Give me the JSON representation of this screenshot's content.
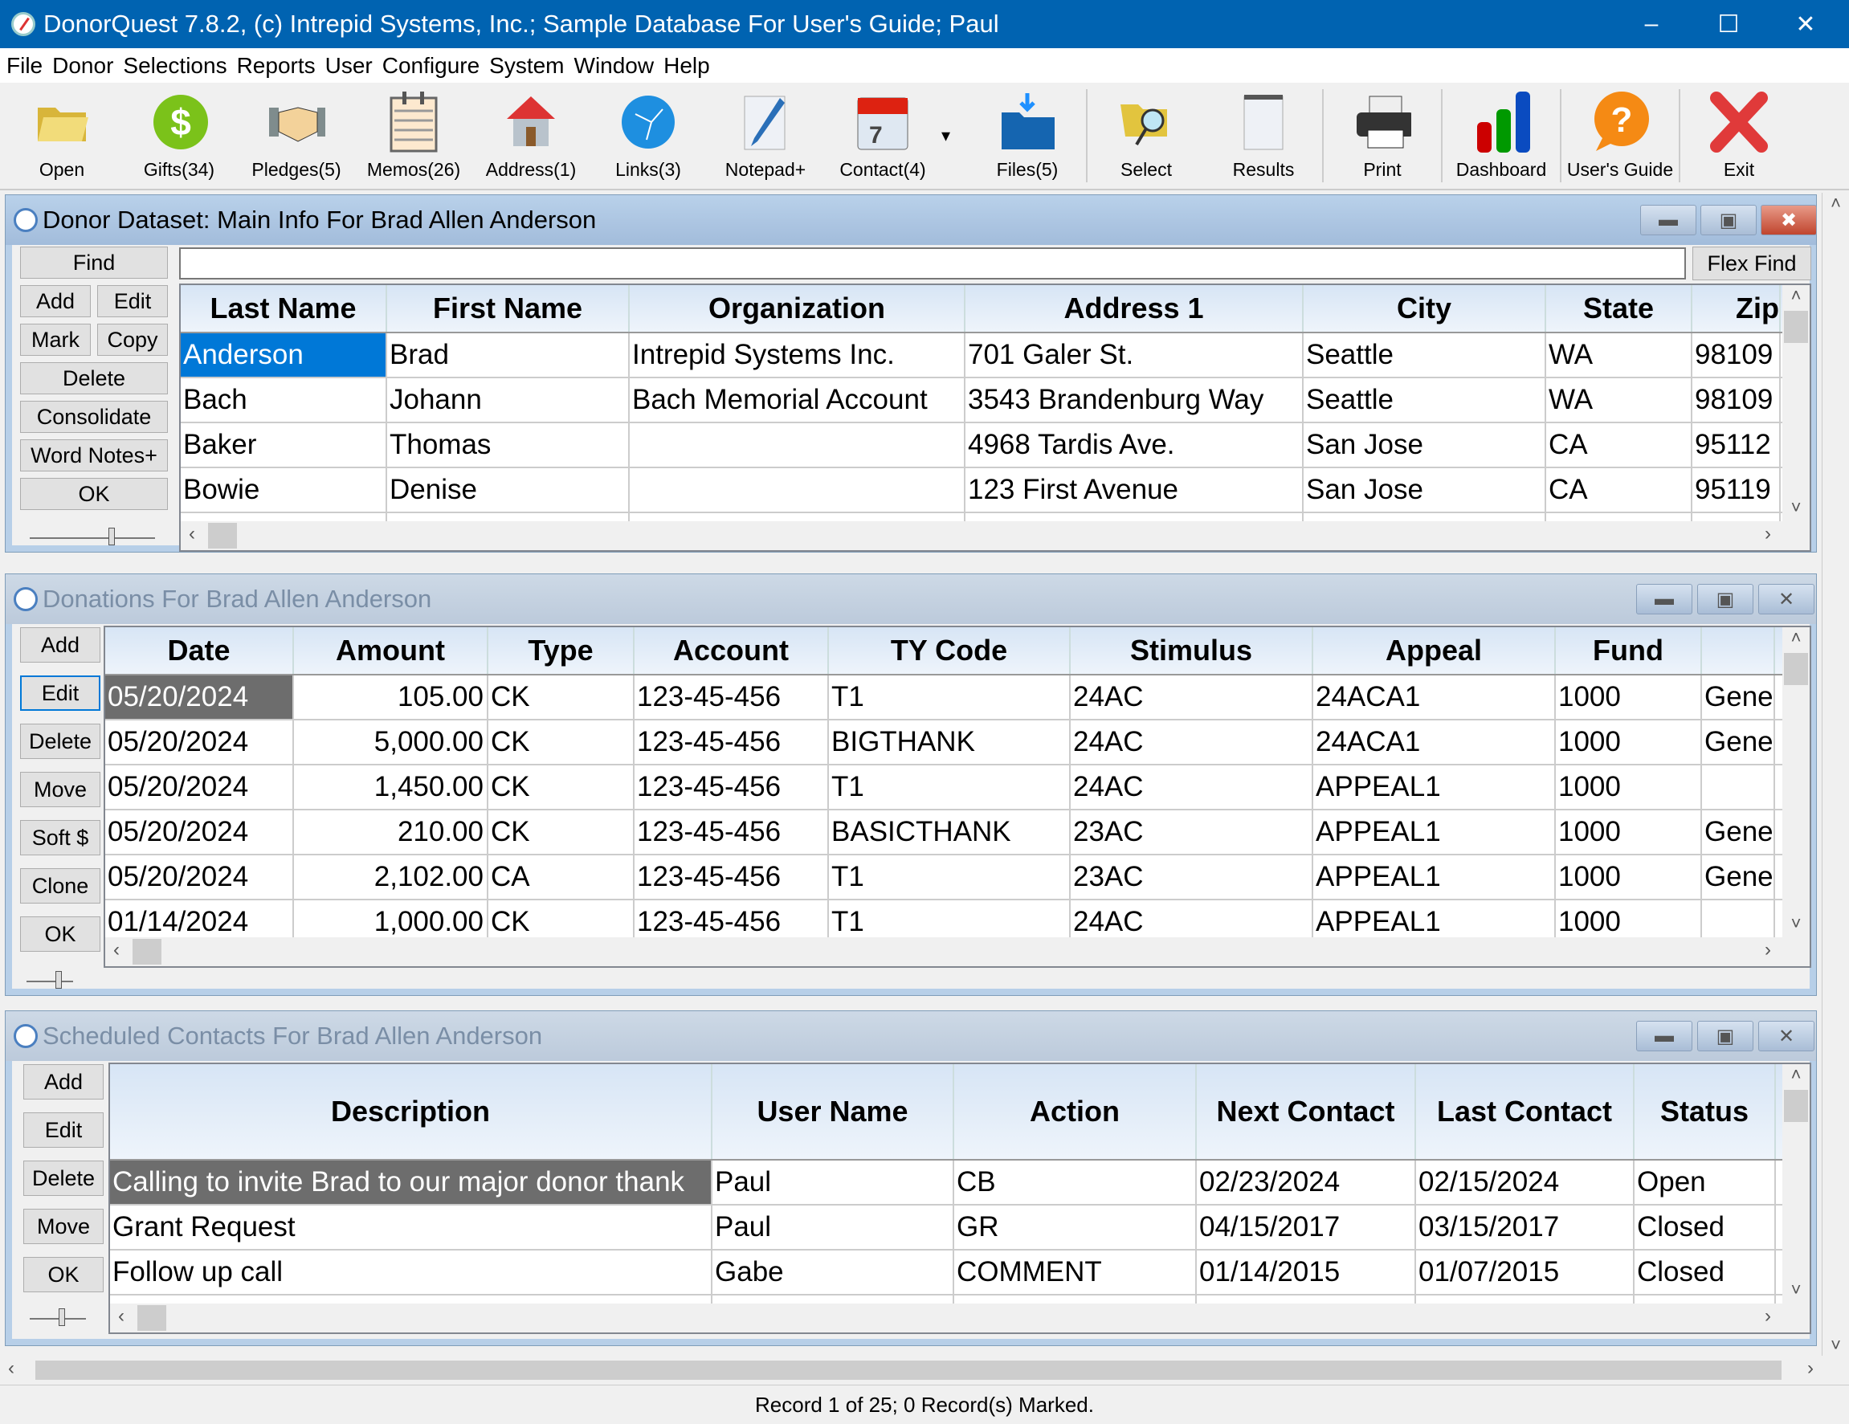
{
  "window": {
    "title": "DonorQuest 7.8.2, (c) Intrepid Systems, Inc.; Sample Database For User's Guide; Paul",
    "minimize": "–",
    "maximize": "☐",
    "close": "✕"
  },
  "menu": [
    "File",
    "Donor",
    "Selections",
    "Reports",
    "User",
    "Configure",
    "System",
    "Window",
    "Help"
  ],
  "toolbar": [
    {
      "label": "Open",
      "icon": "folder-open-icon"
    },
    {
      "label": "Gifts(34)",
      "icon": "dollar-icon"
    },
    {
      "label": "Pledges(5)",
      "icon": "handshake-icon"
    },
    {
      "label": "Memos(26)",
      "icon": "memo-pad-icon"
    },
    {
      "label": "Address(1)",
      "icon": "house-icon"
    },
    {
      "label": "Links(3)",
      "icon": "globe-network-icon"
    },
    {
      "label": "Notepad+",
      "icon": "notepad-pen-icon"
    },
    {
      "label": "Contact(4)",
      "icon": "calendar-icon"
    },
    {
      "label": "Files(5)",
      "icon": "folder-download-icon"
    },
    {
      "label": "Select",
      "icon": "folder-search-icon"
    },
    {
      "label": "Results",
      "icon": "notepad-icon"
    },
    {
      "label": "Print",
      "icon": "printer-icon"
    },
    {
      "label": "Dashboard",
      "icon": "bar-chart-icon"
    },
    {
      "label": "User's Guide",
      "icon": "help-bubble-icon"
    },
    {
      "label": "Exit",
      "icon": "red-x-icon"
    }
  ],
  "donor": {
    "title": "Donor Dataset: Main Info For Brad Allen Anderson",
    "buttons": {
      "find": "Find",
      "add": "Add",
      "edit": "Edit",
      "mark": "Mark",
      "copy": "Copy",
      "delete": "Delete",
      "consolidate": "Consolidate",
      "word_notes": "Word Notes+",
      "ok": "OK"
    },
    "search_value": "",
    "flex_find": "Flex Find",
    "columns": [
      "Last Name",
      "First Name",
      "Organization",
      "Address 1",
      "City",
      "State",
      "Zip"
    ],
    "rows": [
      [
        "Anderson",
        "Brad",
        "Intrepid Systems Inc.",
        "701 Galer St.",
        "Seattle",
        "WA",
        "98109"
      ],
      [
        "Bach",
        "Johann",
        "Bach Memorial Account",
        "3543 Brandenburg Way",
        "Seattle",
        "WA",
        "98109"
      ],
      [
        "Baker",
        "Thomas",
        "",
        "4968 Tardis Ave.",
        "San Jose",
        "CA",
        "95112"
      ],
      [
        "Bowie",
        "Denise",
        "",
        "123 First Avenue",
        "San Jose",
        "CA",
        "95119"
      ]
    ]
  },
  "donations": {
    "title": "Donations For Brad Allen Anderson",
    "buttons": [
      "Add",
      "Edit",
      "Delete",
      "Move",
      "Soft $",
      "Clone",
      "OK"
    ],
    "columns": [
      "Date",
      "Amount",
      "Type",
      "Account",
      "TY Code",
      "Stimulus",
      "Appeal",
      "Fund",
      ""
    ],
    "rows": [
      [
        "05/20/2024",
        "105.00",
        "CK",
        "123-45-456",
        "T1",
        "24AC",
        "24ACA1",
        "1000",
        "Gene"
      ],
      [
        "05/20/2024",
        "5,000.00",
        "CK",
        "123-45-456",
        "BIGTHANK",
        "24AC",
        "24ACA1",
        "1000",
        "Gene"
      ],
      [
        "05/20/2024",
        "1,450.00",
        "CK",
        "123-45-456",
        "T1",
        "24AC",
        "APPEAL1",
        "1000",
        ""
      ],
      [
        "05/20/2024",
        "210.00",
        "CK",
        "123-45-456",
        "BASICTHANK",
        "23AC",
        "APPEAL1",
        "1000",
        "Gene"
      ],
      [
        "05/20/2024",
        "2,102.00",
        "CA",
        "123-45-456",
        "T1",
        "23AC",
        "APPEAL1",
        "1000",
        "Gene"
      ],
      [
        "01/14/2024",
        "1,000.00",
        "CK",
        "123-45-456",
        "T1",
        "24AC",
        "APPEAL1",
        "1000",
        ""
      ]
    ]
  },
  "contacts": {
    "title": "Scheduled Contacts For Brad Allen Anderson",
    "buttons": [
      "Add",
      "Edit",
      "Delete",
      "Move",
      "OK"
    ],
    "columns": [
      "Description",
      "User Name",
      "Action",
      "Next Contact",
      "Last Contact",
      "Status"
    ],
    "rows": [
      [
        "Calling to invite Brad to our major donor thank",
        "Paul",
        "CB",
        "02/23/2024",
        "02/15/2024",
        "Open"
      ],
      [
        "Grant Request",
        "Paul",
        "GR",
        "04/15/2017",
        "03/15/2017",
        "Closed"
      ],
      [
        "Follow up call",
        "Gabe",
        "COMMENT",
        "01/14/2015",
        "01/07/2015",
        "Closed"
      ]
    ]
  },
  "status": "Record 1 of 25; 0 Record(s) Marked.",
  "colors": {
    "titlebar": "#0063b1",
    "selection": "#0078d7",
    "selection_inactive": "#6d6d6d"
  }
}
